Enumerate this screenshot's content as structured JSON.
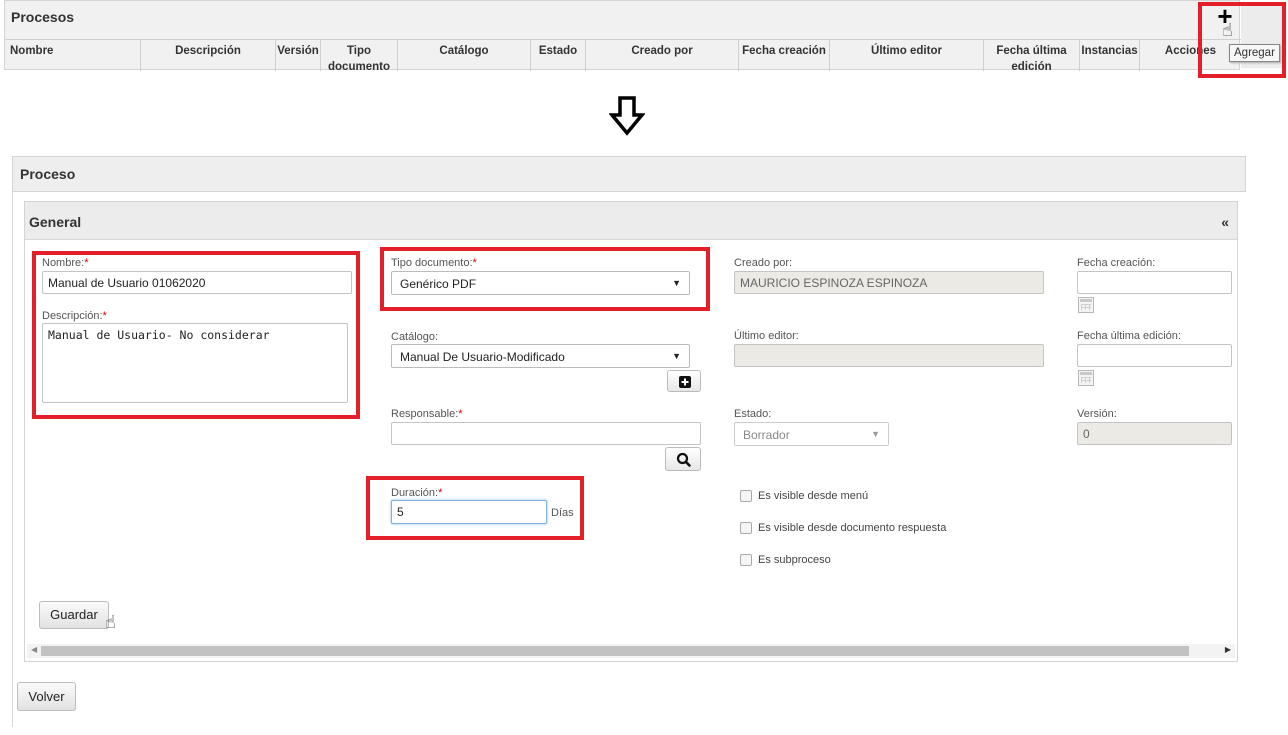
{
  "procesos": {
    "title": "Procesos",
    "columns": [
      "Nombre",
      "Descripción",
      "Versión",
      "Tipo documento",
      "Catálogo",
      "Estado",
      "Creado por",
      "Fecha creación",
      "Último editor",
      "Fecha última edición",
      "Instancias",
      "Acciones"
    ],
    "add_tooltip": "Agregar"
  },
  "proceso": {
    "title": "Proceso",
    "general_title": "General",
    "collapse_label": "«",
    "fields": {
      "nombre": {
        "label": "Nombre:",
        "value": "Manual de Usuario 01062020"
      },
      "descripcion": {
        "label": "Descripción:",
        "value": "Manual de Usuario- No considerar"
      },
      "tipo_documento": {
        "label": "Tipo documento:",
        "value": "Genérico PDF"
      },
      "catalogo": {
        "label": "Catálogo:",
        "value": "Manual De Usuario-Modificado"
      },
      "responsable": {
        "label": "Responsable:",
        "value": ""
      },
      "duracion": {
        "label": "Duración:",
        "value": "5",
        "unit": "Días"
      },
      "creado_por": {
        "label": "Creado por:",
        "value": "MAURICIO ESPINOZA ESPINOZA"
      },
      "ultimo_editor": {
        "label": "Último editor:",
        "value": ""
      },
      "estado": {
        "label": "Estado:",
        "value": "Borrador"
      },
      "fecha_creacion": {
        "label": "Fecha creación:",
        "value": ""
      },
      "fecha_ultima_edicion": {
        "label": "Fecha última edición:",
        "value": ""
      },
      "version": {
        "label": "Versión:",
        "value": "0"
      }
    },
    "required_mark": "*",
    "checkboxes": [
      {
        "label": "Es visible desde menú",
        "checked": false
      },
      {
        "label": "Es visible desde documento respuesta",
        "checked": false
      },
      {
        "label": "Es subproceso",
        "checked": false
      }
    ],
    "save_label": "Guardar",
    "back_label": "Volver"
  },
  "colors": {
    "highlight": "#e3202a",
    "panel_header": "#ececec",
    "focus": "#7fb2e5"
  }
}
